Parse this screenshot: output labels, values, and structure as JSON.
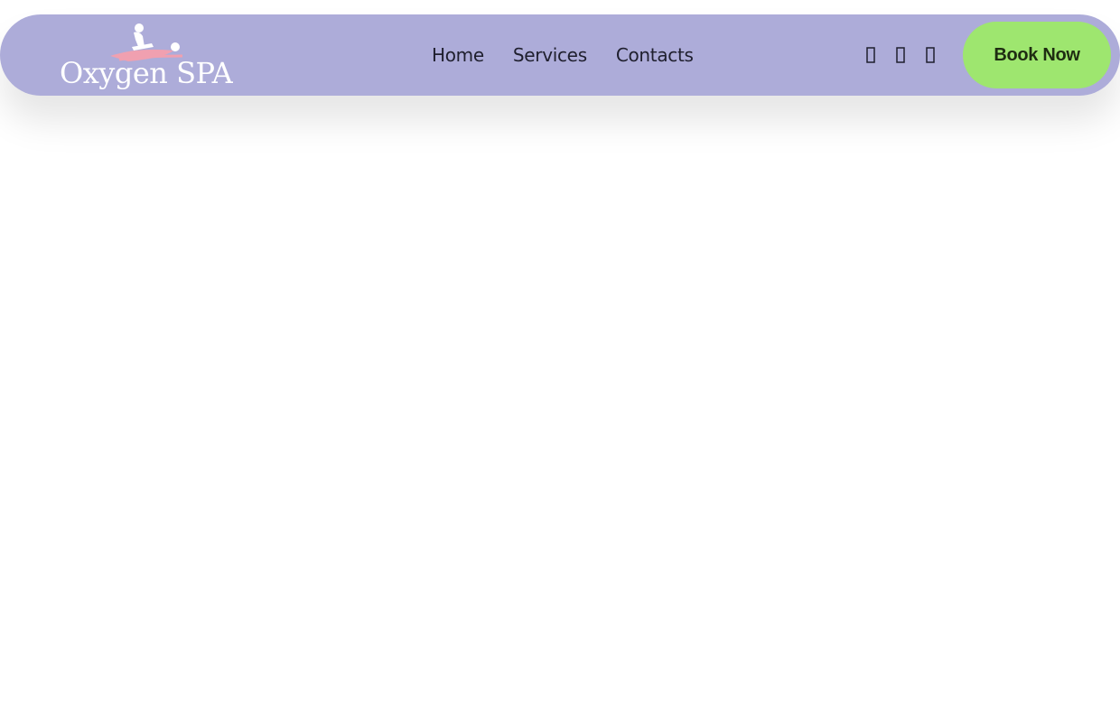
{
  "header": {
    "logo": {
      "text": "Oxygen SPA",
      "icon": "massage-figure-icon"
    },
    "nav": [
      {
        "label": "Home"
      },
      {
        "label": "Services"
      },
      {
        "label": "Contacts"
      }
    ],
    "social": [
      {
        "icon": "social-icon-1"
      },
      {
        "icon": "social-icon-2"
      },
      {
        "icon": "social-icon-3"
      }
    ],
    "cta": {
      "label": "Book Now"
    }
  },
  "colors": {
    "navbar_bg": "#adacd9",
    "cta_bg": "#9ee66f",
    "text": "#1f1f2e",
    "logo_accent": "#f0a0b0"
  }
}
